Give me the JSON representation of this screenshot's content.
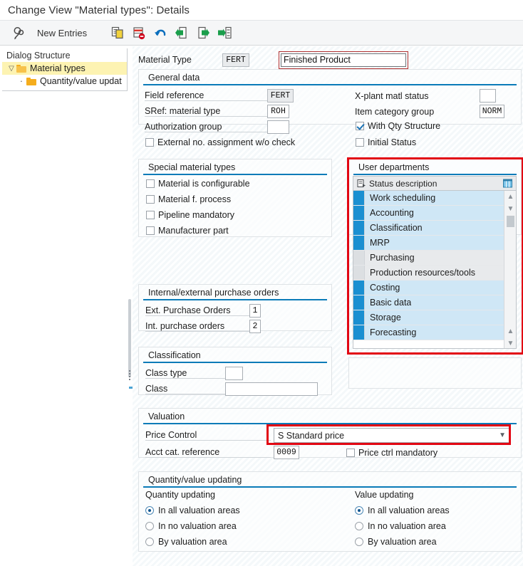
{
  "window": {
    "title": "Change View \"Material types\": Details"
  },
  "toolbar": {
    "items": [
      {
        "name": "display-change-icon",
        "label": ""
      },
      {
        "name": "new-entries-button",
        "label": "New Entries"
      },
      {
        "name": "copy-icon",
        "label": ""
      },
      {
        "name": "delete-icon",
        "label": ""
      },
      {
        "name": "undo-icon",
        "label": ""
      },
      {
        "name": "previous-entry-icon",
        "label": ""
      },
      {
        "name": "next-entry-icon",
        "label": ""
      },
      {
        "name": "last-entry-icon",
        "label": ""
      }
    ]
  },
  "sidebar": {
    "title": "Dialog Structure",
    "items": [
      {
        "label": "Material types",
        "selected": true
      },
      {
        "label": "Quantity/value updat",
        "selected": false
      }
    ]
  },
  "header": {
    "material_type_label": "Material Type",
    "material_type_code": "FERT",
    "material_type_desc": "Finished Product"
  },
  "general_data": {
    "title": "General data",
    "field_reference_label": "Field reference",
    "field_reference_value": "FERT",
    "sref_label": "SRef: material type",
    "sref_value": "ROH",
    "auth_group_label": "Authorization group",
    "auth_group_value": "",
    "external_no_label": "External no. assignment w/o check",
    "external_no_checked": false,
    "xplant_label": "X-plant matl status",
    "xplant_value": "",
    "item_cat_label": "Item category group",
    "item_cat_value": "NORM",
    "with_qty_label": "With Qty Structure",
    "with_qty_checked": true,
    "initial_status_label": "Initial Status",
    "initial_status_checked": false
  },
  "special_material_types": {
    "title": "Special material types",
    "items": [
      {
        "label": "Material is configurable",
        "checked": false
      },
      {
        "label": "Material f. process",
        "checked": false
      },
      {
        "label": "Pipeline mandatory",
        "checked": false
      },
      {
        "label": "Manufacturer part",
        "checked": false
      }
    ]
  },
  "purchase_orders": {
    "title": "Internal/external purchase orders",
    "ext_label": "Ext. Purchase Orders",
    "ext_value": "1",
    "int_label": "Int. purchase orders",
    "int_value": "2"
  },
  "classification": {
    "title": "Classification",
    "class_type_label": "Class type",
    "class_type_value": "",
    "class_label": "Class",
    "class_value": ""
  },
  "user_departments": {
    "title": "User departments",
    "column_header": "Status description",
    "rows": [
      {
        "label": "Work scheduling",
        "selected": true
      },
      {
        "label": "Accounting",
        "selected": true
      },
      {
        "label": "Classification",
        "selected": true
      },
      {
        "label": "MRP",
        "selected": true
      },
      {
        "label": "Purchasing",
        "selected": false
      },
      {
        "label": "Production resources/tools",
        "selected": false
      },
      {
        "label": "Costing",
        "selected": true
      },
      {
        "label": "Basic data",
        "selected": true
      },
      {
        "label": "Storage",
        "selected": true
      },
      {
        "label": "Forecasting",
        "selected": true
      }
    ]
  },
  "valuation": {
    "title": "Valuation",
    "price_control_label": "Price Control",
    "price_control_value": "S Standard price",
    "acct_cat_label": "Acct cat. reference",
    "acct_cat_value": "0009",
    "price_ctrl_mandatory_label": "Price ctrl mandatory",
    "price_ctrl_mandatory_checked": false
  },
  "qty_value_updating": {
    "title": "Quantity/value updating",
    "quantity": {
      "heading": "Quantity updating",
      "options": [
        {
          "label": "In all valuation areas",
          "selected": true
        },
        {
          "label": "In no valuation area",
          "selected": false
        },
        {
          "label": "By valuation area",
          "selected": false
        }
      ]
    },
    "value": {
      "heading": "Value updating",
      "options": [
        {
          "label": "In all valuation areas",
          "selected": true
        },
        {
          "label": "In no valuation area",
          "selected": false
        },
        {
          "label": "By valuation area",
          "selected": false
        }
      ]
    }
  },
  "colors": {
    "accent": "#0a7bb8",
    "highlight_red": "#e20613",
    "selection_blue": "#1a8fd1",
    "tree_selected": "#fdf3b2"
  }
}
